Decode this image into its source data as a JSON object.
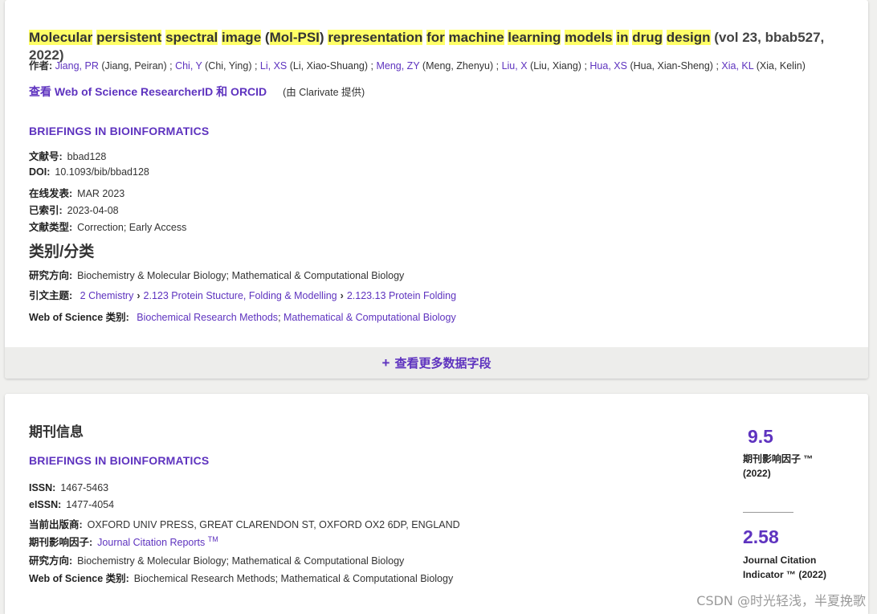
{
  "record": {
    "title_words": [
      "Molecular",
      "persistent",
      "spectral",
      "image",
      "(",
      "Mol-PSI",
      ")",
      "representation",
      "for",
      "machine",
      "learning",
      "models",
      "in",
      "drug",
      "design"
    ],
    "title_suffix": "(vol 23, bbab527, 2022)",
    "authors_label": "作者:",
    "authors": [
      {
        "short": "Jiang, PR",
        "full": "(Jiang, Peiran)"
      },
      {
        "short": "Chi, Y",
        "full": "(Chi, Ying)"
      },
      {
        "short": "Li, XS",
        "full": "(Li, Xiao-Shuang)"
      },
      {
        "short": "Meng, ZY",
        "full": "(Meng, Zhenyu)"
      },
      {
        "short": "Liu, X",
        "full": "(Liu, Xiang)"
      },
      {
        "short": "Hua, XS",
        "full": "(Hua, Xian-Sheng)"
      },
      {
        "short": "Xia, KL",
        "full": "(Xia, Kelin)"
      }
    ],
    "researcher_link": "查看 Web of Science ResearcherID 和 ORCID",
    "researcher_provider": "(由 Clarivate 提供)",
    "journal": "BRIEFINGS IN BIOINFORMATICS",
    "fields": {
      "article_no_label": "文献号:",
      "article_no": "bbad128",
      "doi_label": "DOI:",
      "doi": "10.1093/bib/bbad128",
      "online_label": "在线发表:",
      "online": "MAR 2023",
      "indexed_label": "已索引:",
      "indexed": "2023-04-08",
      "doctype_label": "文献类型:",
      "doctype": "Correction; Early Access"
    },
    "category_heading": "类别/分类",
    "research_area_label": "研究方向:",
    "research_area": "Biochemistry & Molecular Biology; Mathematical & Computational Biology",
    "citation_topic_label": "引文主题:",
    "citation_topics": [
      "2 Chemistry",
      "2.123 Protein Stucture, Folding & Modelling",
      "2.123.13 Protein Folding"
    ],
    "wos_category_label": "Web of Science 类别:",
    "wos_categories": [
      "Biochemical Research Methods",
      "Mathematical & Computational Biology"
    ],
    "more_fields": "查看更多数据字段"
  },
  "journal_info": {
    "heading": "期刊信息",
    "journal": "BRIEFINGS IN BIOINFORMATICS",
    "issn_label": "ISSN:",
    "issn": "1467-5463",
    "eissn_label": "eISSN:",
    "eissn": "1477-4054",
    "publisher_label": "当前出版商:",
    "publisher": "OXFORD UNIV PRESS, GREAT CLARENDON ST, OXFORD OX2 6DP, ENGLAND",
    "impact_label": "期刊影响因子:",
    "impact_link": "Journal Citation Reports",
    "impact_tm": "TM",
    "research_area_label": "研究方向:",
    "research_area": "Biochemistry & Molecular Biology; Mathematical & Computational Biology",
    "wos_category_label": "Web of Science 类别:",
    "wos_category": "Biochemical Research Methods; Mathematical & Computational Biology",
    "metrics": [
      {
        "value": "9.5",
        "label1": "期刊影响因子 ™",
        "label2": "(2022)"
      },
      {
        "value": "2.58",
        "label1": "Journal Citation",
        "label2": "Indicator ™ (2022)"
      }
    ]
  },
  "watermark": "CSDN @时光轻浅，半夏挽歌",
  "colors": {
    "link": "#5e33bf",
    "highlight": "#ffff66"
  }
}
